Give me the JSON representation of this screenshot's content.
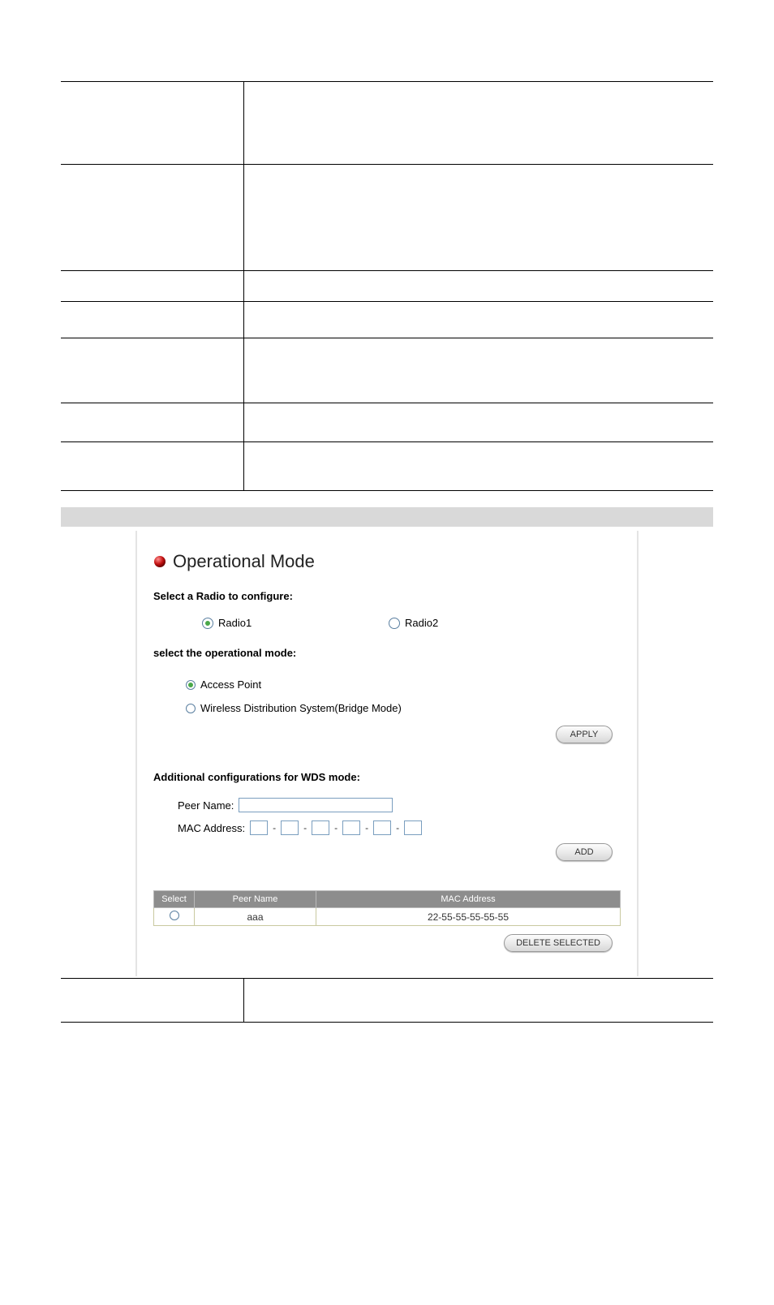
{
  "top_rows": [
    102,
    131,
    38,
    45,
    80,
    48,
    60
  ],
  "panel": {
    "title": "Operational Mode",
    "select_radio_h": "Select a Radio to configure:",
    "radio1": "Radio1",
    "radio2": "Radio2",
    "select_mode_h": "select the operational mode:",
    "mode_ap": "Access Point",
    "mode_wds": "Wireless Distribution System(Bridge Mode)",
    "apply": "APPLY",
    "wds_h": "Additional configurations for WDS mode:",
    "peer_name_lbl": "Peer Name:",
    "mac_lbl": "MAC Address:",
    "add": "ADD",
    "table": {
      "h_select": "Select",
      "h_peer": "Peer Name",
      "h_mac": "MAC Address",
      "row": {
        "peer": "aaa",
        "mac": "22-55-55-55-55-55"
      }
    },
    "delete": "DELETE SELECTED"
  },
  "bottom_rows": [
    54
  ]
}
